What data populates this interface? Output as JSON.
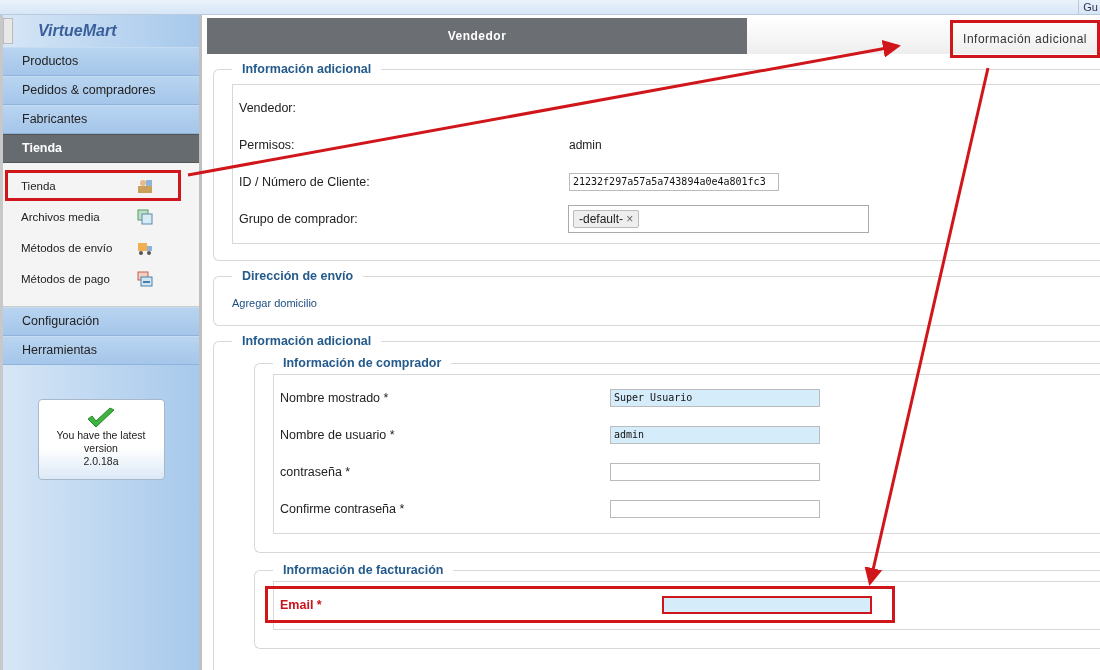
{
  "top_bar": {
    "text": "Gu"
  },
  "sidebar": {
    "logo": "VirtueMart",
    "menu": [
      {
        "label": "Productos",
        "selected": false
      },
      {
        "label": "Pedidos & compradores",
        "selected": false
      },
      {
        "label": "Fabricantes",
        "selected": false
      },
      {
        "label": "Tienda",
        "selected": true,
        "children": [
          {
            "label": "Tienda",
            "kind": "store",
            "annotated": true
          },
          {
            "label": "Archivos media",
            "kind": "media",
            "annotated": false
          },
          {
            "label": "Métodos de envío",
            "kind": "truck",
            "annotated": false
          },
          {
            "label": "Métodos de pago",
            "kind": "payment",
            "annotated": false
          }
        ]
      },
      {
        "label": "Configuración",
        "selected": false
      },
      {
        "label": "Herramientas",
        "selected": false
      }
    ],
    "version_box": {
      "lines": [
        "You have the latest version",
        "2.0.18a"
      ]
    }
  },
  "tabs": [
    {
      "label": "Vendedor",
      "selected": true,
      "annotated": false
    },
    {
      "label": "Información adicional",
      "selected": false,
      "annotated": true
    }
  ],
  "sections": [
    {
      "title": "Información adicional",
      "rows": [
        {
          "label": "Vendedor:",
          "kind": "empty"
        },
        {
          "label": "Permisos:",
          "kind": "text",
          "value": "admin"
        },
        {
          "label": "ID / Número de Cliente:",
          "kind": "input",
          "value": "21232f297a57a5a743894a0e4a801fc3",
          "highlighted": false
        },
        {
          "label": "Grupo de comprador:",
          "kind": "tags",
          "tags": [
            {
              "label": "-default-",
              "remove": "×"
            }
          ]
        }
      ]
    },
    {
      "title": "Dirección de envío",
      "link": "Agregar domicilio"
    },
    {
      "title": "Información adicional",
      "subsections": [
        {
          "title": "Información de comprador",
          "rows": [
            {
              "label": "Nombre mostrado *",
              "kind": "input",
              "value": "Super Usuario",
              "highlighted": true
            },
            {
              "label": "Nombre de usuario *",
              "kind": "input",
              "value": "admin",
              "highlighted": true
            },
            {
              "label": "contraseña *",
              "kind": "input",
              "value": "",
              "highlighted": false
            },
            {
              "label": "Confirme contraseña *",
              "kind": "input",
              "value": "",
              "highlighted": false
            }
          ]
        },
        {
          "title": "Información de facturación",
          "rows": [
            {
              "label": "Email *",
              "kind": "input",
              "value": "",
              "highlighted": true,
              "error": true,
              "annotated": true
            }
          ]
        }
      ]
    }
  ]
}
